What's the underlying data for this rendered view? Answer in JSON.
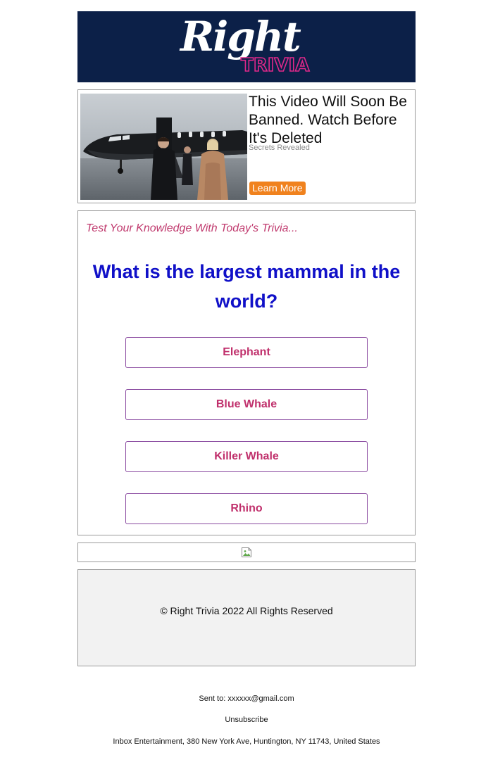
{
  "header": {
    "logo_script": "Right",
    "logo_sub": "TRIVIA",
    "background": "#0c2048",
    "accent": "#e0288a"
  },
  "ad": {
    "title": "This Video Will Soon Be Banned. Watch Before It's Deleted",
    "source": "Secrets Revealed",
    "button_label": "Learn More",
    "button_color": "#f0821e"
  },
  "trivia": {
    "intro": "Test Your Knowledge With Today's Trivia...",
    "question": "What is the largest mammal in the world?",
    "answers": [
      "Elephant",
      "Blue Whale",
      "Killer Whale",
      "Rhino"
    ],
    "question_color": "#1010c8",
    "answer_color": "#c0306c"
  },
  "footer": {
    "copyright": "© Right Trivia 2022 All Rights Reserved",
    "sent_to_label": "Sent to:",
    "sent_to_email": "xxxxxx@gmail.com",
    "unsubscribe": "Unsubscribe",
    "address": "Inbox Entertainment, 380 New York Ave, Huntington, NY 11743, United States"
  }
}
